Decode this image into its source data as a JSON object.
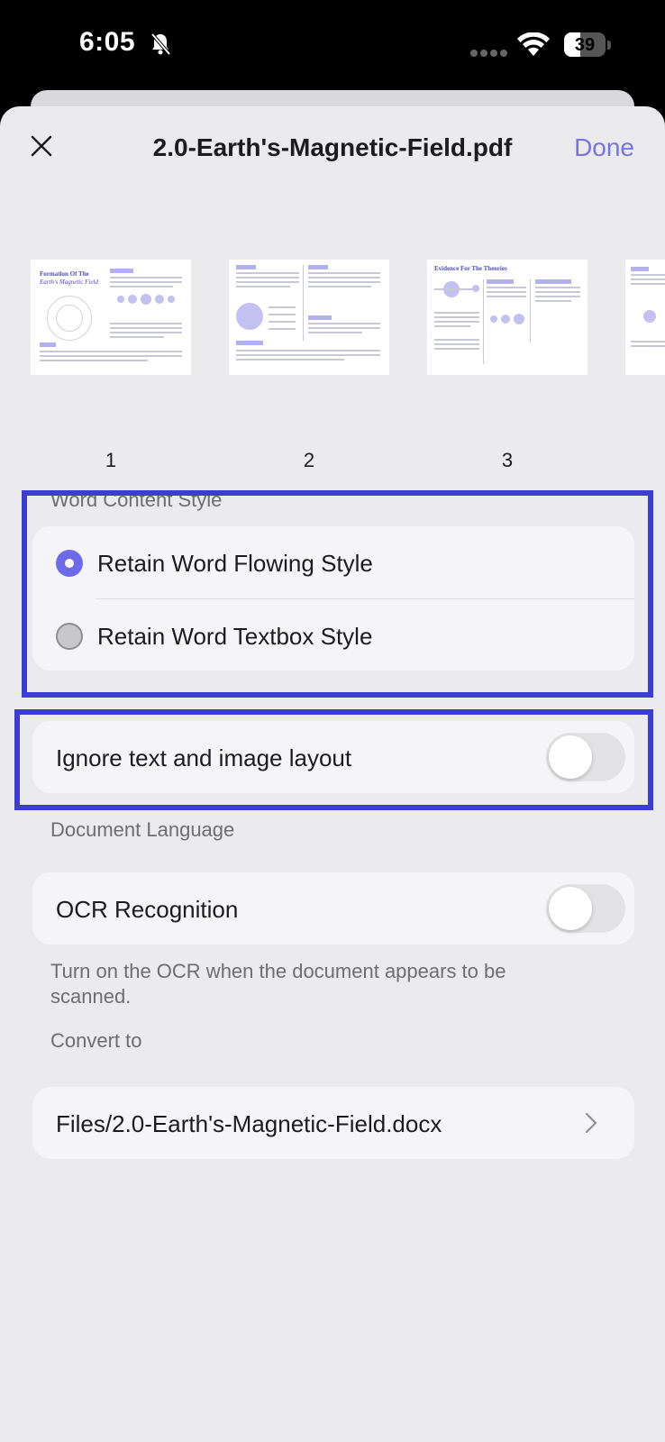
{
  "status_bar": {
    "time": "6:05",
    "battery": "39"
  },
  "header": {
    "title": "2.0-Earth's-Magnetic-Field.pdf",
    "done_label": "Done"
  },
  "thumbnails": [
    {
      "page": "1",
      "heading_line1": "Formation Of The",
      "heading_line2": "Earth's Magnetic Field"
    },
    {
      "page": "2"
    },
    {
      "page": "3",
      "heading": "Evidence For The Theories"
    }
  ],
  "word_content": {
    "section_label": "Word Content Style",
    "options": [
      {
        "label": "Retain Word Flowing Style",
        "selected": true
      },
      {
        "label": "Retain Word Textbox Style",
        "selected": false
      }
    ]
  },
  "layout_option": {
    "label": "Ignore text and image layout",
    "enabled": false
  },
  "language": {
    "section_label": "Document Language",
    "ocr_label": "OCR Recognition",
    "ocr_enabled": false,
    "ocr_note": "Turn on the OCR when the document appears to be scanned."
  },
  "convert": {
    "section_label": "Convert to",
    "path": "Files/2.0-Earth's-Magnetic-Field.docx"
  },
  "colors": {
    "accent": "#7674e0",
    "highlight": "#3c3cd6",
    "sheet": "#ebebed"
  }
}
